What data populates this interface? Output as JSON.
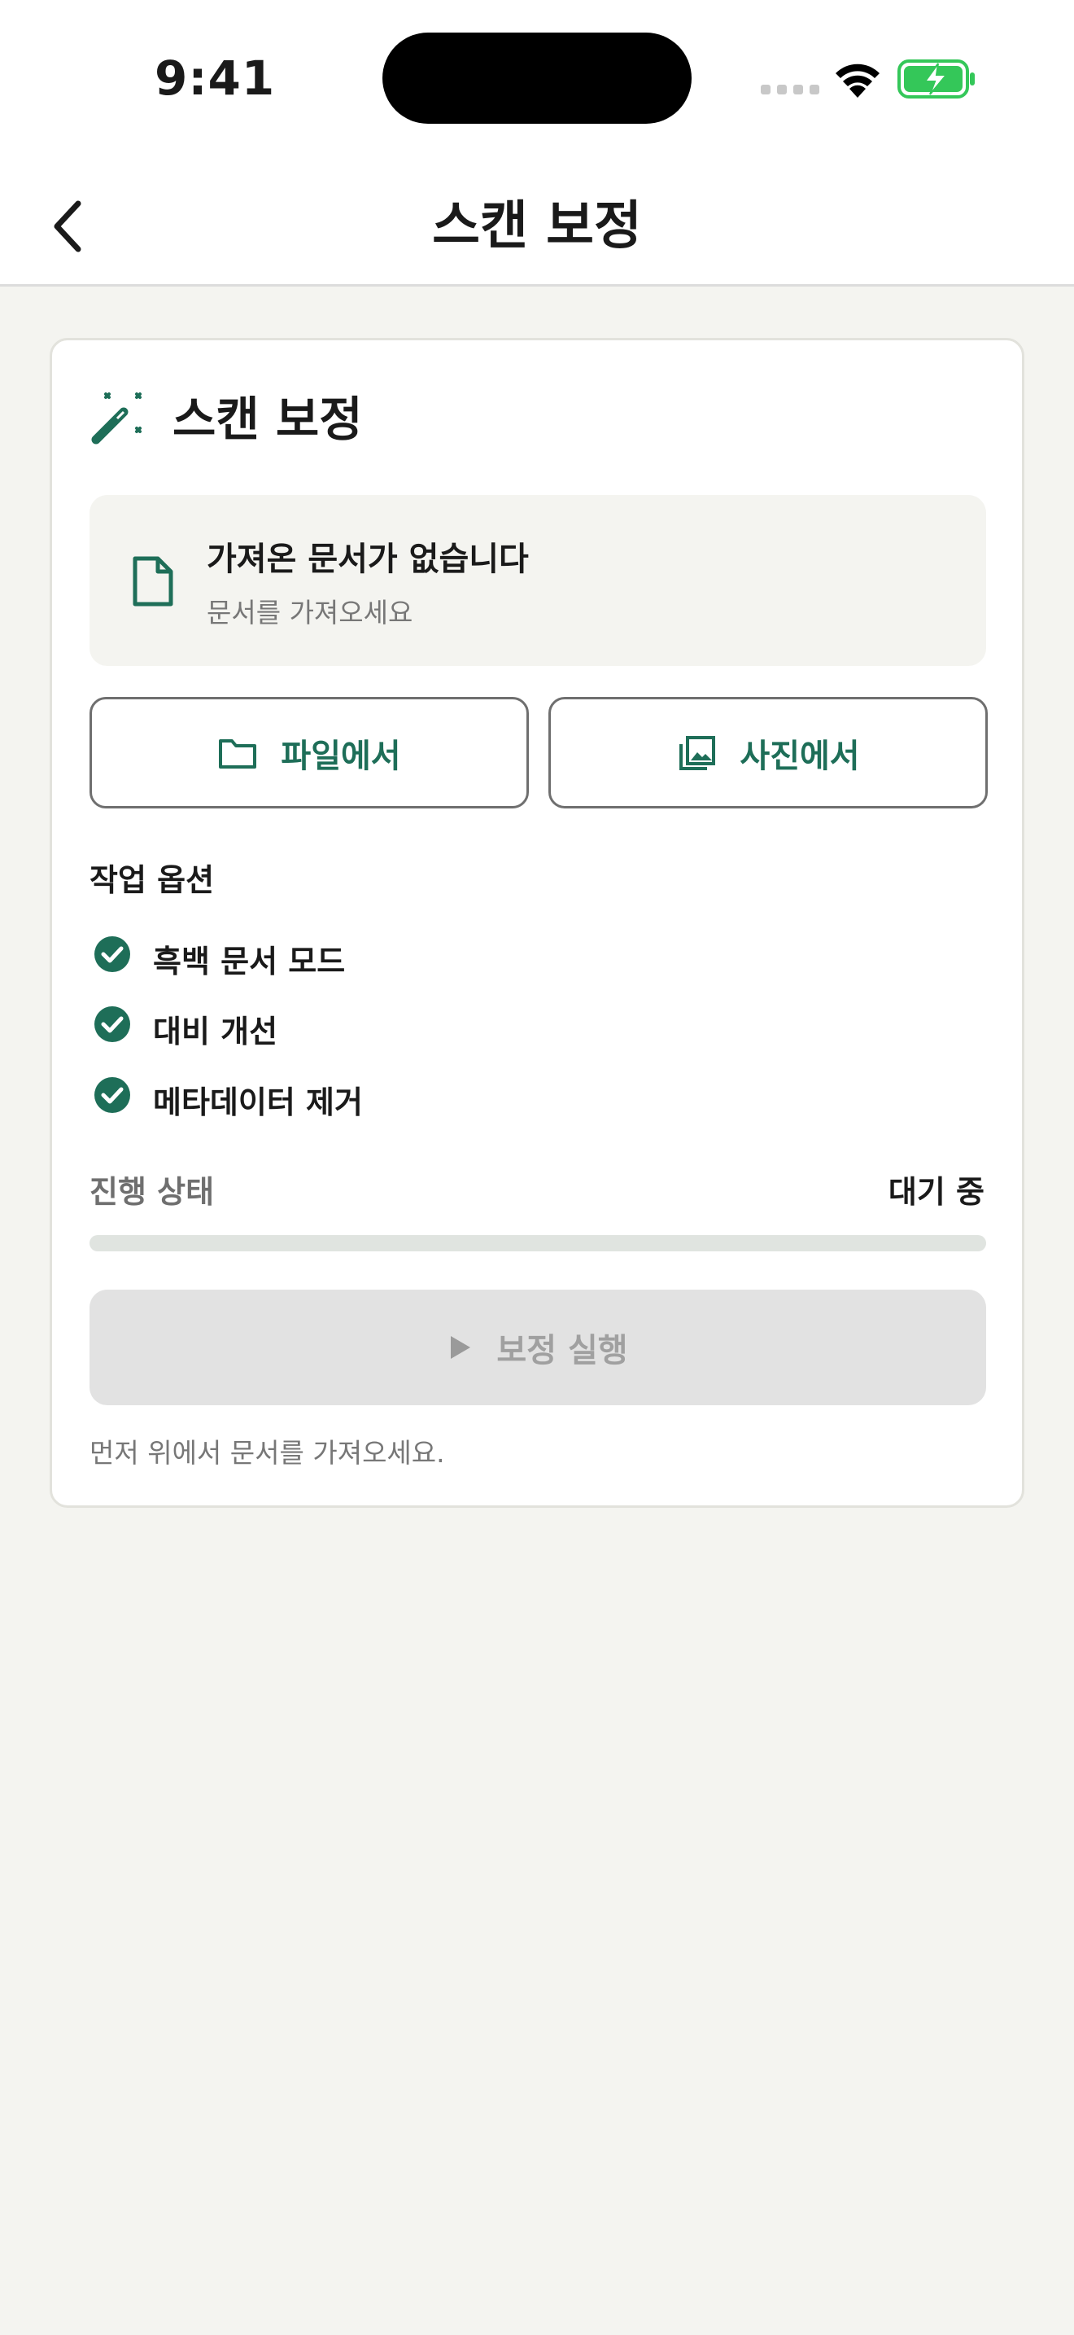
{
  "status_bar": {
    "time": "9:41"
  },
  "nav": {
    "title": "스캔 보정"
  },
  "card": {
    "title": "스캔 보정",
    "document": {
      "title": "가져온 문서가 없습니다",
      "subtitle": "문서를 가져오세요"
    },
    "buttons": {
      "from_file": "파일에서",
      "from_photo": "사진에서"
    },
    "options_title": "작업 옵션",
    "options": [
      {
        "label": "흑백 문서 모드",
        "checked": true
      },
      {
        "label": "대비 개선",
        "checked": true
      },
      {
        "label": "메타데이터 제거",
        "checked": true
      }
    ],
    "progress": {
      "label": "진행 상태",
      "status": "대기 중",
      "value": 0
    },
    "run_button": "보정 실행",
    "hint": "먼저 위에서 문서를 가져오세요."
  },
  "colors": {
    "accent": "#1e6e58",
    "background": "#f4f4f0",
    "battery_green": "#34c759"
  },
  "icons": {
    "back": "chevron-left-icon",
    "wand": "magic-wand-icon",
    "document": "document-icon",
    "folder": "folder-icon",
    "photos": "photo-library-icon",
    "check": "check-circle-icon",
    "play": "play-icon"
  }
}
